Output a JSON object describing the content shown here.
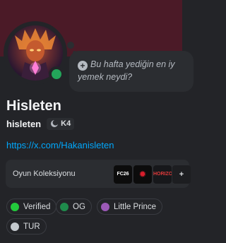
{
  "profile": {
    "display_name": "Hisleten",
    "username": "hisleten",
    "badge_label": "K4",
    "status": "online",
    "status_color": "#23a55a",
    "banner_color": "#4b1a27",
    "link": "https://x.com/Hakanisleten"
  },
  "status_bubble": {
    "text_line1": "Bu hafta yediğin en iy",
    "text_line2": "yemek neydi?"
  },
  "collection": {
    "label": "Oyun Koleksiyonu",
    "games": [
      {
        "label": "FC26",
        "icon": "fc26-icon"
      },
      {
        "label": "✹",
        "icon": "spider-icon"
      },
      {
        "label": "HORIZON",
        "icon": "forza-horizon-icon"
      },
      {
        "label": "+",
        "icon": "more-games-icon"
      }
    ]
  },
  "roles": [
    {
      "label": "Verified",
      "color": "#23ca3c"
    },
    {
      "label": "OG",
      "color": "#1f8b4c"
    },
    {
      "label": "Little Prince",
      "color": "#9b59b6"
    },
    {
      "label": "TUR",
      "color": "#c4c9ce"
    }
  ]
}
